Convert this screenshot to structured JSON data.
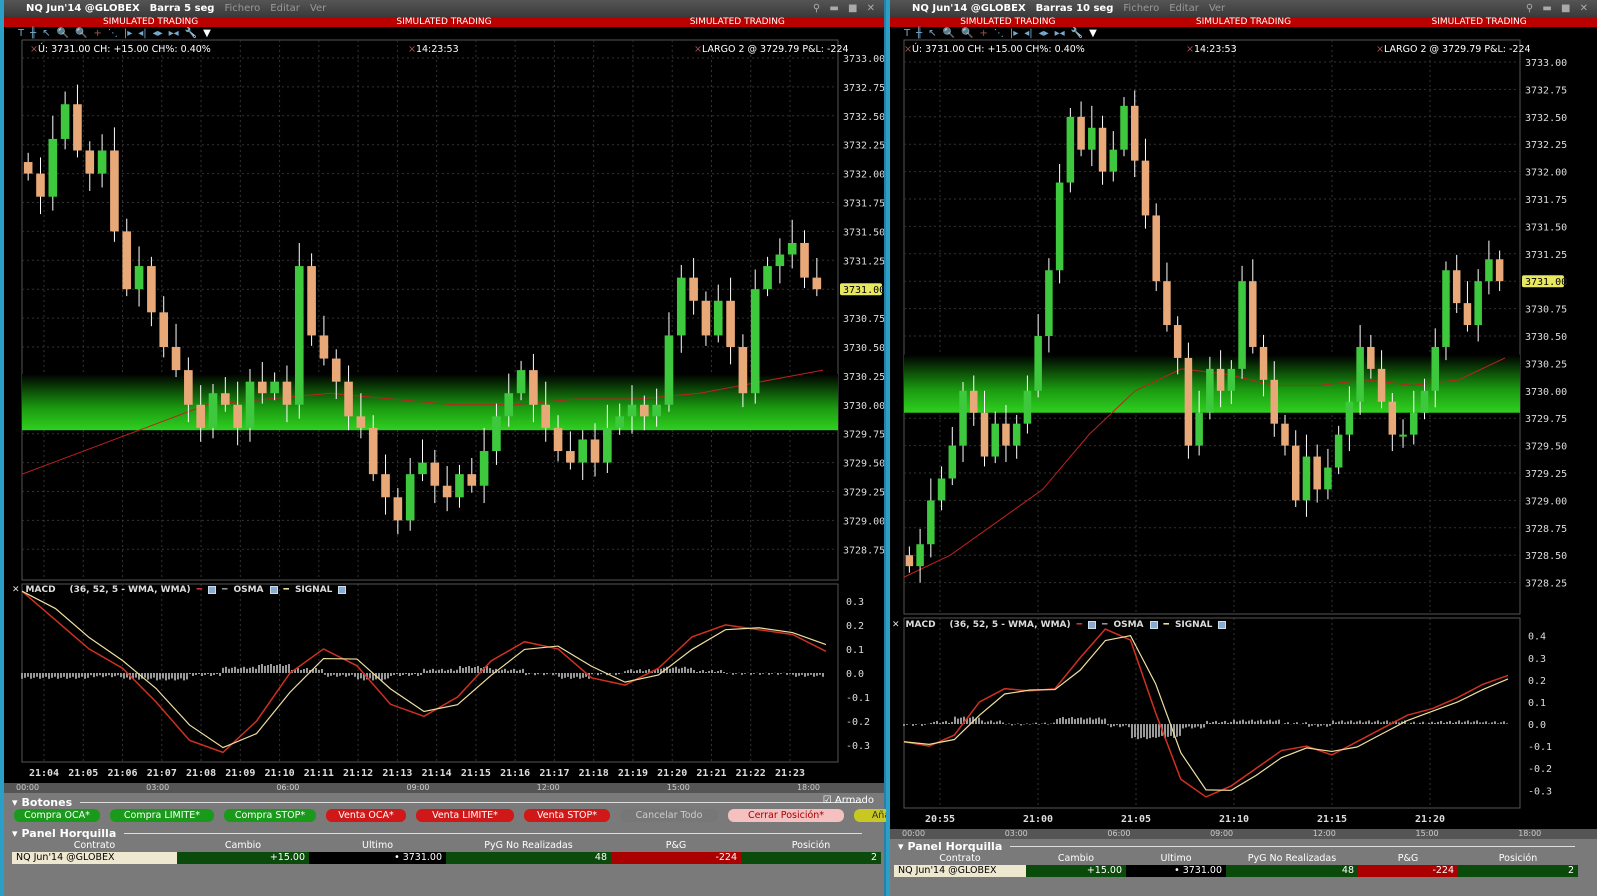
{
  "windows": [
    {
      "id": "left",
      "contract": "NQ Jun'14 @GLOBEX",
      "timeframe": "Barra 5 seg",
      "menus": [
        "Fichero",
        "Editar",
        "Ver"
      ],
      "banner": "SIMULATED TRADING",
      "info_left": "Ú: 3731.00 CH: +15.00 CH%: 0.40%",
      "info_time": "14:23:53",
      "info_pos": "LARGO 2 @ 3729.79   P&L: -224",
      "last_price_label": "3731.00",
      "macd_title": "MACD",
      "macd_params": "(36, 52, 5 - WMA, WMA)",
      "osma": "OSMA",
      "signal": "SIGNAL",
      "nav_labels": [
        "00:00",
        "03:00",
        "06:00",
        "09:00",
        "12:00",
        "15:00",
        "18:00"
      ],
      "buttons_title": "Botones",
      "armed": "Armado",
      "buttons": [
        {
          "label": "Compra OCA*",
          "color": "#1a9a1a"
        },
        {
          "label": "Compra LIMITE*",
          "color": "#1a9a1a"
        },
        {
          "label": "Compra STOP*",
          "color": "#1a9a1a"
        },
        {
          "label": "Venta OCA*",
          "color": "#d01818"
        },
        {
          "label": "Venta LIMITE*",
          "color": "#d01818"
        },
        {
          "label": "Venta STOP*",
          "color": "#d01818"
        },
        {
          "label": "Cancelar Todo",
          "color": "#777"
        },
        {
          "label": "Cerrar Posición*",
          "color": "#f4c0c0"
        },
        {
          "label": "Añadir Alerta",
          "color": "#c8c820"
        }
      ],
      "panel_title": "Panel Horquilla",
      "table_headers": [
        "Contrato",
        "Cambio",
        "Último",
        "PyG No Realizadas",
        "P&G",
        "Posición"
      ],
      "table_row": [
        "NQ Jun'14 @GLOBEX",
        "+15.00",
        "3731.00",
        "48",
        "-224",
        "2"
      ]
    },
    {
      "id": "right",
      "contract": "NQ Jun'14 @GLOBEX",
      "timeframe": "Barras 10 seg",
      "menus": [
        "Fichero",
        "Editar",
        "Ver"
      ],
      "banner": "SIMULATED TRADING",
      "info_left": "Ú: 3731.00 CH: +15.00 CH%: 0.40%",
      "info_time": "14:23:53",
      "info_pos": "LARGO 2 @ 3729.79   P&L: -224",
      "last_price_label": "3731.00",
      "macd_title": "MACD",
      "macd_params": "(36, 52, 5 - WMA, WMA)",
      "osma": "OSMA",
      "signal": "SIGNAL",
      "nav_labels": [
        "00:00",
        "03:00",
        "06:00",
        "09:00",
        "12:00",
        "15:00",
        "18:00"
      ],
      "panel_title": "Panel Horquilla",
      "table_headers": [
        "Contrato",
        "Cambio",
        "Último",
        "PyG No Realizadas",
        "P&G",
        "Posición"
      ],
      "table_row": [
        "NQ Jun'14 @GLOBEX",
        "+15.00",
        "3731.00",
        "48",
        "-224",
        "2"
      ]
    }
  ],
  "chart_data": [
    {
      "type": "candlestick",
      "title": "NQ Jun'14 Barra 5 seg",
      "ylim": [
        3728.6,
        3733.1
      ],
      "yticks": [
        "3733.00",
        "3732.75",
        "3732.50",
        "3732.25",
        "3732.00",
        "3731.75",
        "3731.50",
        "3731.25",
        "3731.00",
        "3730.75",
        "3730.50",
        "3730.25",
        "3730.00",
        "3729.75",
        "3729.50",
        "3729.25",
        "3729.00",
        "3728.75"
      ],
      "xticks": [
        "21:04",
        "21:05",
        "21:06",
        "21:07",
        "21:08",
        "21:09",
        "21:10",
        "21:11",
        "21:12",
        "21:13",
        "21:14",
        "21:15",
        "21:16",
        "21:17",
        "21:18",
        "21:19",
        "21:20",
        "21:21",
        "21:22",
        "21:23"
      ],
      "closes": [
        3732.0,
        3731.8,
        3732.3,
        3732.6,
        3732.2,
        3732.0,
        3732.2,
        3731.5,
        3731.0,
        3731.2,
        3730.8,
        3730.5,
        3730.3,
        3730.0,
        3729.8,
        3730.1,
        3730.0,
        3729.8,
        3730.2,
        3730.1,
        3730.2,
        3730.0,
        3731.2,
        3730.6,
        3730.4,
        3730.2,
        3729.9,
        3729.8,
        3729.4,
        3729.2,
        3729.0,
        3729.4,
        3729.5,
        3729.3,
        3729.2,
        3729.4,
        3729.3,
        3729.6,
        3729.9,
        3730.1,
        3730.3,
        3730.0,
        3729.8,
        3729.6,
        3729.5,
        3729.7,
        3729.5,
        3729.8,
        3729.9,
        3730.0,
        3729.9,
        3730.0,
        3730.6,
        3731.1,
        3730.9,
        3730.6,
        3730.9,
        3730.5,
        3730.1,
        3731.0,
        3731.2,
        3731.3,
        3731.4,
        3731.1,
        3731.0
      ],
      "ma": [
        3729.4,
        3729.6,
        3729.8,
        3730.0,
        3730.05,
        3730.1,
        3730.05,
        3730.0,
        3730.0,
        3730.05,
        3730.05,
        3730.1,
        3730.2,
        3730.3
      ],
      "band": [
        3729.78,
        3730.05
      ],
      "macd": {
        "ylim": [
          -0.37,
          0.37
        ],
        "yticks": [
          "0.3",
          "0.2",
          "0.1",
          "0.0",
          "-0.1",
          "-0.2",
          "-0.3"
        ],
        "line": [
          0.34,
          0.22,
          0.1,
          0.02,
          -0.12,
          -0.28,
          -0.33,
          -0.2,
          0.0,
          0.1,
          0.03,
          -0.13,
          -0.18,
          -0.1,
          0.05,
          0.13,
          0.1,
          -0.02,
          -0.05,
          0.02,
          0.15,
          0.2,
          0.18,
          0.16,
          0.09
        ]
      }
    },
    {
      "type": "candlestick",
      "title": "NQ Jun'14 Barras 10 seg",
      "ylim": [
        3728.1,
        3733.1
      ],
      "yticks": [
        "3733.00",
        "3732.75",
        "3732.50",
        "3732.25",
        "3732.00",
        "3731.75",
        "3731.50",
        "3731.25",
        "3731.00",
        "3730.75",
        "3730.50",
        "3730.25",
        "3730.00",
        "3729.75",
        "3729.50",
        "3729.25",
        "3729.00",
        "3728.75",
        "3728.50",
        "3728.25"
      ],
      "xticks": [
        "20:55",
        "21:00",
        "21:05",
        "21:10",
        "21:15",
        "21:20"
      ],
      "closes": [
        3728.4,
        3728.6,
        3729.0,
        3729.2,
        3729.5,
        3730.0,
        3729.8,
        3729.4,
        3729.7,
        3729.5,
        3729.7,
        3730.0,
        3730.5,
        3731.1,
        3731.9,
        3732.5,
        3732.2,
        3732.4,
        3732.0,
        3732.2,
        3732.6,
        3732.1,
        3731.6,
        3731.0,
        3730.6,
        3730.3,
        3729.5,
        3729.8,
        3730.2,
        3730.0,
        3730.2,
        3731.0,
        3730.4,
        3730.1,
        3729.7,
        3729.5,
        3729.0,
        3729.4,
        3729.1,
        3729.3,
        3729.6,
        3729.9,
        3730.4,
        3730.2,
        3729.9,
        3729.6,
        3729.6,
        3729.8,
        3730.0,
        3730.4,
        3731.1,
        3730.8,
        3730.6,
        3731.0,
        3731.2,
        3731.0
      ],
      "ma": [
        3728.3,
        3728.5,
        3728.8,
        3729.1,
        3729.6,
        3730.0,
        3730.2,
        3730.15,
        3730.05,
        3730.05,
        3730.1,
        3730.05,
        3730.1,
        3730.3
      ],
      "band": [
        3729.8,
        3730.1
      ],
      "macd": {
        "ylim": [
          -0.38,
          0.48
        ],
        "yticks": [
          "0.4",
          "0.3",
          "0.2",
          "0.1",
          "0.0",
          "-0.1",
          "-0.2",
          "-0.3"
        ],
        "line": [
          -0.08,
          -0.1,
          -0.05,
          0.1,
          0.16,
          0.15,
          0.16,
          0.3,
          0.43,
          0.38,
          0.05,
          -0.25,
          -0.33,
          -0.28,
          -0.2,
          -0.12,
          -0.1,
          -0.14,
          -0.08,
          -0.02,
          0.04,
          0.07,
          0.12,
          0.18,
          0.22
        ]
      }
    }
  ]
}
